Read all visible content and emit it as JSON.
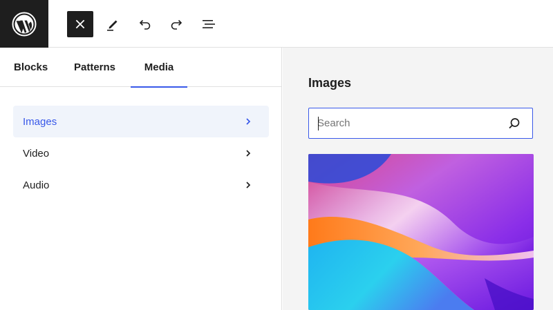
{
  "toolbar": {
    "logo_icon": "wordpress-logo-icon",
    "buttons": [
      {
        "name": "close-icon"
      },
      {
        "name": "pencil-icon"
      },
      {
        "name": "undo-icon"
      },
      {
        "name": "redo-icon"
      },
      {
        "name": "list-view-icon"
      }
    ],
    "accent_color": "#3858e9"
  },
  "inserter": {
    "tabs": [
      {
        "label": "Blocks"
      },
      {
        "label": "Patterns"
      },
      {
        "label": "Media",
        "selected": true
      }
    ],
    "categories": [
      {
        "label": "Images",
        "selected": true
      },
      {
        "label": "Video"
      },
      {
        "label": "Audio"
      }
    ]
  },
  "media_panel": {
    "title": "Images",
    "search": {
      "placeholder": "Search",
      "value": ""
    }
  }
}
